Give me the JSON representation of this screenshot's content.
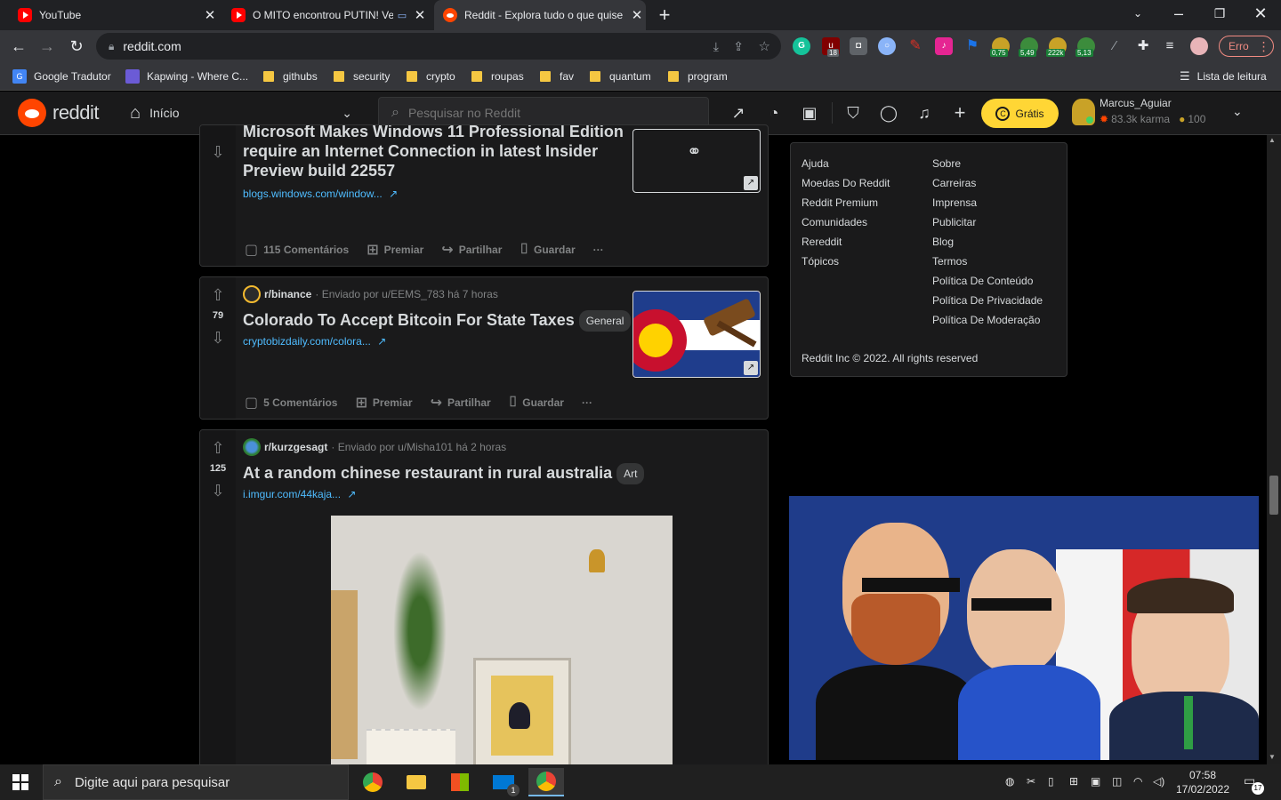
{
  "browser": {
    "tabs": [
      {
        "title": "YouTube",
        "icon": "youtube-icon"
      },
      {
        "title": "O MITO encontrou PUTIN! Ve",
        "icon": "youtube-icon"
      },
      {
        "title": "Reddit - Explora tudo o que quise",
        "icon": "reddit-icon"
      }
    ],
    "new_tab": "+",
    "url": "reddit.com",
    "extensions": [
      {
        "name": "grammarly-icon",
        "label": "G",
        "color": "#15c39a"
      },
      {
        "name": "ublock-icon",
        "label": "u",
        "badge": "18",
        "color": "#800000"
      },
      {
        "name": "camera-icon",
        "label": "",
        "color": "#5f6368"
      },
      {
        "name": "lens-icon",
        "label": "",
        "color": "#8ab4f8"
      },
      {
        "name": "pen-icon",
        "label": "",
        "color": "#d93025"
      },
      {
        "name": "mic-icon",
        "label": "",
        "color": "#e52592"
      },
      {
        "name": "flag-icon",
        "label": "",
        "color": "#1a73e8"
      },
      {
        "name": "coin-ext-1-icon",
        "badge": "0,75",
        "color": "#c9a227"
      },
      {
        "name": "coin-ext-2-icon",
        "badge": "5,49",
        "color": "#3c8c3c"
      },
      {
        "name": "coin-ext-3-icon",
        "badge": "222k",
        "color": "#c9a227"
      },
      {
        "name": "coin-ext-4-icon",
        "badge": "5,13",
        "color": "#3c8c3c"
      }
    ],
    "profile_error": "Erro",
    "bookmarks": [
      {
        "label": "Google Tradutor",
        "type": "site"
      },
      {
        "label": "Kapwing - Where C...",
        "type": "site"
      },
      {
        "label": "githubs",
        "type": "folder"
      },
      {
        "label": "security",
        "type": "folder"
      },
      {
        "label": "crypto",
        "type": "folder"
      },
      {
        "label": "roupas",
        "type": "folder"
      },
      {
        "label": "fav",
        "type": "folder"
      },
      {
        "label": "quantum",
        "type": "folder"
      },
      {
        "label": "program",
        "type": "folder"
      }
    ],
    "reading_list": "Lista de leitura"
  },
  "reddit": {
    "wordmark": "reddit",
    "home_label": "Início",
    "search_placeholder": "Pesquisar no Reddit",
    "free_button": "Grátis",
    "user": {
      "name": "Marcus_Aguiar",
      "karma": "83.3k karma",
      "coins": "100"
    }
  },
  "posts": [
    {
      "title_line1": "Microsoft Makes Windows 11 Professional Edition",
      "title_line2": "require an Internet Connection in latest Insider",
      "title_line3": "Preview build 22557",
      "link": "blogs.windows.com/window...",
      "comments": "115 Comentários",
      "award": "Premiar",
      "share": "Partilhar",
      "save": "Guardar",
      "more": "···"
    },
    {
      "subreddit": "r/binance",
      "meta": "· Enviado por u/EEMS_783 há 7 horas",
      "score": "79",
      "title": "Colorado To Accept Bitcoin For State Taxes",
      "flair": "General",
      "link": "cryptobizdaily.com/colora...",
      "comments": "5 Comentários",
      "award": "Premiar",
      "share": "Partilhar",
      "save": "Guardar",
      "more": "···"
    },
    {
      "subreddit": "r/kurzgesagt",
      "meta": "· Enviado por u/Misha101 há 2 horas",
      "score": "125",
      "title": "At a random chinese restaurant in rural australia",
      "flair": "Art",
      "link": "i.imgur.com/44kaja..."
    }
  ],
  "footer": {
    "col1": [
      "Ajuda",
      "Moedas Do Reddit",
      "Reddit Premium",
      "Comunidades",
      "Rereddit",
      "Tópicos"
    ],
    "col2": [
      "Sobre",
      "Carreiras",
      "Imprensa",
      "Publicitar",
      "Blog",
      "Termos",
      "Política De Conteúdo",
      "Política De Privacidade",
      "Política De Moderação"
    ],
    "copyright": "Reddit Inc © 2022. All rights reserved"
  },
  "taskbar": {
    "search_placeholder": "Digite aqui para pesquisar",
    "time": "07:58",
    "date": "17/02/2022",
    "notifications": "17",
    "mail_badge": "1"
  }
}
